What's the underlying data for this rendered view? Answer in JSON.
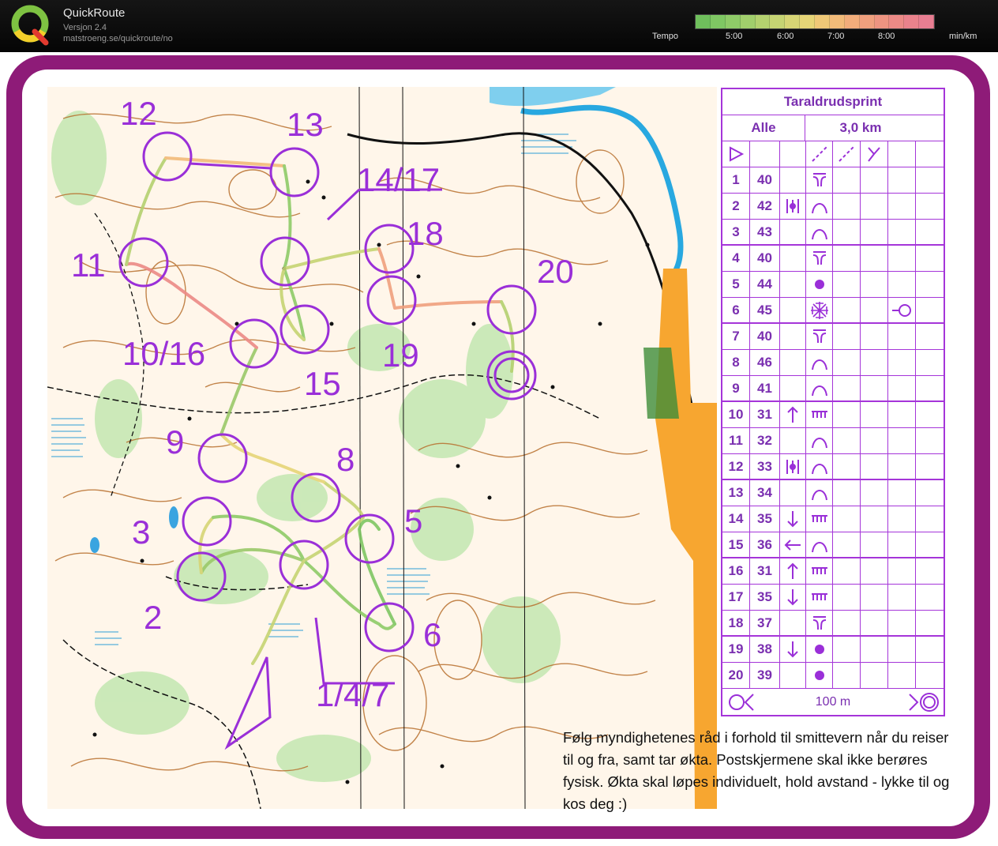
{
  "header": {
    "app_title": "QuickRoute",
    "version": "Versjon 2.4",
    "url": "matstroeng.se/quickroute/no",
    "pace_label": "Tempo",
    "pace_ticks": [
      "5:00",
      "6:00",
      "7:00",
      "8:00"
    ],
    "pace_unit": "min/km",
    "pace_colors": [
      "#6fbf5c",
      "#7fc763",
      "#8fcb68",
      "#a1ce6c",
      "#b4d16f",
      "#c6d473",
      "#d7d575",
      "#e6d577",
      "#efc877",
      "#f2bb79",
      "#f2ad7b",
      "#f0a07e",
      "#ee9481",
      "#ec8a86",
      "#ea828c",
      "#e87e92"
    ]
  },
  "description": {
    "event": "Taraldrudsprint",
    "class": "Alle",
    "distance": "3,0 km",
    "controls": [
      {
        "n": "1",
        "code": "40",
        "direction": "",
        "feature": "reentrant-end"
      },
      {
        "n": "2",
        "code": "42",
        "direction": "between",
        "feature": "knoll"
      },
      {
        "n": "3",
        "code": "43",
        "direction": "",
        "feature": "knoll"
      },
      {
        "n": "4",
        "code": "40",
        "direction": "",
        "feature": "reentrant-end"
      },
      {
        "n": "5",
        "code": "44",
        "direction": "",
        "feature": "boulder"
      },
      {
        "n": "6",
        "code": "45",
        "direction": "",
        "feature": "thicket",
        "extra": "finish-side"
      },
      {
        "n": "7",
        "code": "40",
        "direction": "",
        "feature": "reentrant-end"
      },
      {
        "n": "8",
        "code": "46",
        "direction": "",
        "feature": "knoll"
      },
      {
        "n": "9",
        "code": "41",
        "direction": "",
        "feature": "knoll"
      },
      {
        "n": "10",
        "code": "31",
        "direction": "up",
        "feature": "cliff"
      },
      {
        "n": "11",
        "code": "32",
        "direction": "",
        "feature": "knoll"
      },
      {
        "n": "12",
        "code": "33",
        "direction": "between",
        "feature": "knoll"
      },
      {
        "n": "13",
        "code": "34",
        "direction": "",
        "feature": "knoll"
      },
      {
        "n": "14",
        "code": "35",
        "direction": "down",
        "feature": "cliff"
      },
      {
        "n": "15",
        "code": "36",
        "direction": "left",
        "feature": "knoll"
      },
      {
        "n": "16",
        "code": "31",
        "direction": "up",
        "feature": "cliff"
      },
      {
        "n": "17",
        "code": "35",
        "direction": "down",
        "feature": "cliff"
      },
      {
        "n": "18",
        "code": "37",
        "direction": "",
        "feature": "reentrant-end"
      },
      {
        "n": "19",
        "code": "38",
        "direction": "down",
        "feature": "boulder"
      },
      {
        "n": "20",
        "code": "39",
        "direction": "",
        "feature": "boulder"
      }
    ],
    "finish_text": "100 m"
  },
  "map": {
    "control_labels": [
      {
        "id": "12",
        "text": "12"
      },
      {
        "id": "13",
        "text": "13"
      },
      {
        "id": "14-17",
        "text": "14/17"
      },
      {
        "id": "11",
        "text": "11"
      },
      {
        "id": "18",
        "text": "18"
      },
      {
        "id": "20",
        "text": "20"
      },
      {
        "id": "10-16",
        "text": "10/16"
      },
      {
        "id": "19",
        "text": "19"
      },
      {
        "id": "15",
        "text": "15"
      },
      {
        "id": "9",
        "text": "9"
      },
      {
        "id": "8",
        "text": "8"
      },
      {
        "id": "3",
        "text": "3"
      },
      {
        "id": "5",
        "text": "5"
      },
      {
        "id": "2",
        "text": "2"
      },
      {
        "id": "6",
        "text": "6"
      },
      {
        "id": "1-4-7",
        "text": "1/4/7"
      }
    ]
  },
  "notice": "Følg myndighetenes råd i forhold til smittevern når du reiser til og fra, samt tar økta. Postskjermene skal ikke berøres fysisk. Økta skal løpes individuelt, hold avstand - lykke til og kos deg :)"
}
